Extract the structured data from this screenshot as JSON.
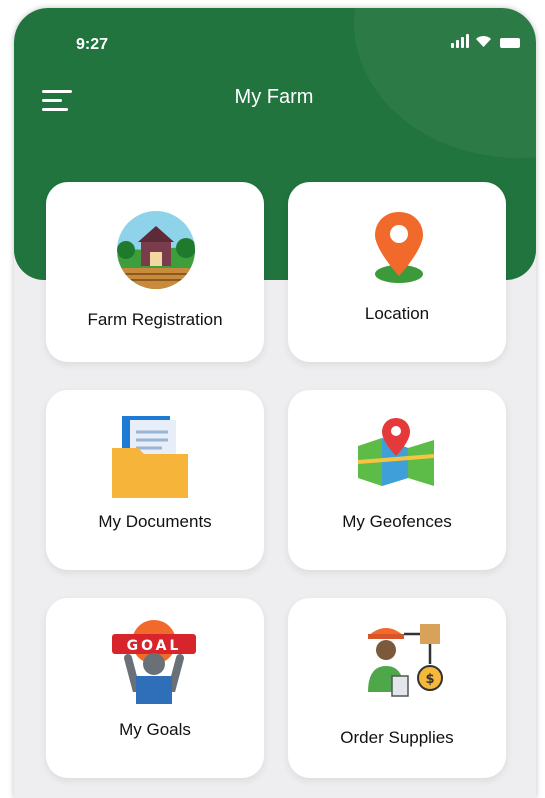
{
  "status_bar": {
    "time": "9:27"
  },
  "header": {
    "title": "My Farm"
  },
  "cards": [
    {
      "label": "Farm Registration",
      "icon": "farm-barn-icon"
    },
    {
      "label": "Location",
      "icon": "location-pin-icon"
    },
    {
      "label": "My Documents",
      "icon": "folder-documents-icon"
    },
    {
      "label": "My Geofences",
      "icon": "map-geofence-icon"
    },
    {
      "label": "My Goals",
      "icon": "goal-sign-icon"
    },
    {
      "label": "Order Supplies",
      "icon": "supply-chain-icon"
    }
  ],
  "colors": {
    "brand_green": "#21743e",
    "background": "#eeeef0",
    "card": "#ffffff"
  }
}
